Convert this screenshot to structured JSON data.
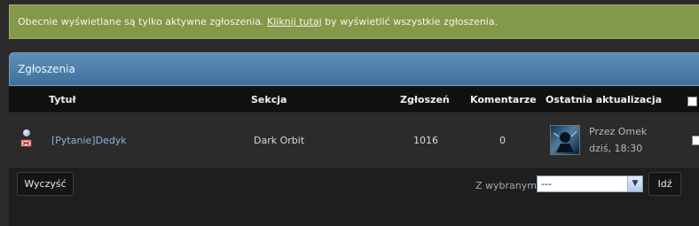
{
  "notice": {
    "before": "Obecnie wyświetlane są tylko aktywne zgłoszenia. ",
    "link": "Kliknij tutaj",
    "after": " by wyświetlić wszystkie zgłoszenia."
  },
  "panel": {
    "title": "Zgłoszenia"
  },
  "columns": {
    "title": "Tytuł",
    "section": "Sekcja",
    "reports": "Zgłoszeń",
    "comments": "Komentarze",
    "last_update": "Ostatnia aktualizacja"
  },
  "rows": [
    {
      "title": "[Pytanie]Dedyk",
      "section": "Dark Orbit",
      "reports": "1016",
      "comments": "0",
      "by": "Przez Omek",
      "time": "dziś, 18:30"
    }
  ],
  "footer": {
    "clear_label": "Wyczyść",
    "with_selected_label": "Z wybranymi:",
    "select_value": "---",
    "go_label": "Idź"
  },
  "colors": {
    "notice_bg": "#839848",
    "header_bg": "#4f80ab",
    "link": "#8cb4e0"
  }
}
